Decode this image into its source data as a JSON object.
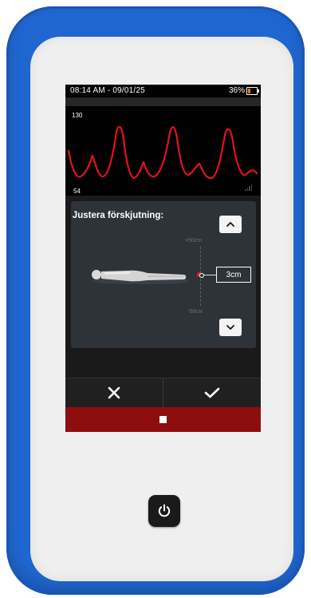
{
  "status_bar": {
    "time": "08:14 AM - 09/01/25",
    "battery_percent": "36%",
    "battery_level": 0.36,
    "battery_color": "#ff7a00"
  },
  "waveform": {
    "scale_max": "130",
    "scale_min": "54",
    "trace_color": "#e3121d"
  },
  "adjust_panel": {
    "title": "Justera förskjutning:",
    "scale_top": "+50cm",
    "scale_bottom": "-50cm",
    "offset_value": "3cm",
    "up_icon": "chevron-up-icon",
    "down_icon": "chevron-down-icon"
  },
  "actions": {
    "cancel_icon": "close-icon",
    "confirm_icon": "checkmark-icon"
  },
  "stop_bar": {
    "icon": "stop-icon",
    "color": "#8e0e0e"
  },
  "device": {
    "frame_color": "#1f66d0",
    "power_icon": "power-icon"
  }
}
